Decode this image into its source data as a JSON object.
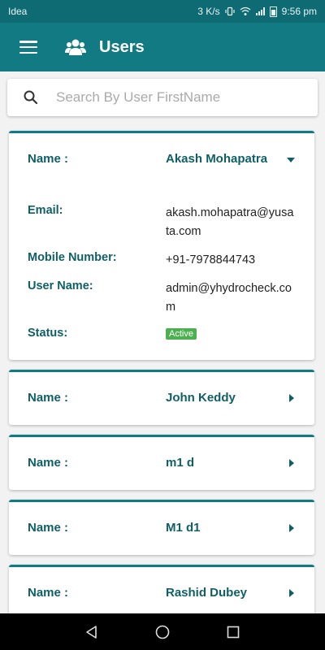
{
  "status_bar": {
    "carrier": "Idea",
    "speed": "3 K/s",
    "time": "9:56 pm"
  },
  "app_bar": {
    "title": "Users",
    "menu_icon": "hamburger-menu-icon",
    "title_icon": "users-group-icon"
  },
  "search": {
    "placeholder": "Search By User FirstName",
    "value": ""
  },
  "users": [
    {
      "name_label": "Name :",
      "name": "Akash Mohapatra",
      "expanded": true,
      "email_label": "Email:",
      "email": "akash.mohapatra@yusata.com",
      "mobile_label": "Mobile Number:",
      "mobile": "+91-7978844743",
      "username_label": "User Name:",
      "username": "admin@yhydrocheck.com",
      "status_label": "Status:",
      "status": "Active"
    },
    {
      "name_label": "Name :",
      "name": "John Keddy",
      "expanded": false
    },
    {
      "name_label": "Name :",
      "name": "m1 d",
      "expanded": false
    },
    {
      "name_label": "Name :",
      "name": "M1 d1",
      "expanded": false
    },
    {
      "name_label": "Name :",
      "name": "Rashid Dubey",
      "expanded": false
    }
  ],
  "colors": {
    "primary": "#117a82",
    "status_bar": "#0f6b73",
    "label_text": "#0f5f66",
    "active_badge": "#4caf50"
  }
}
